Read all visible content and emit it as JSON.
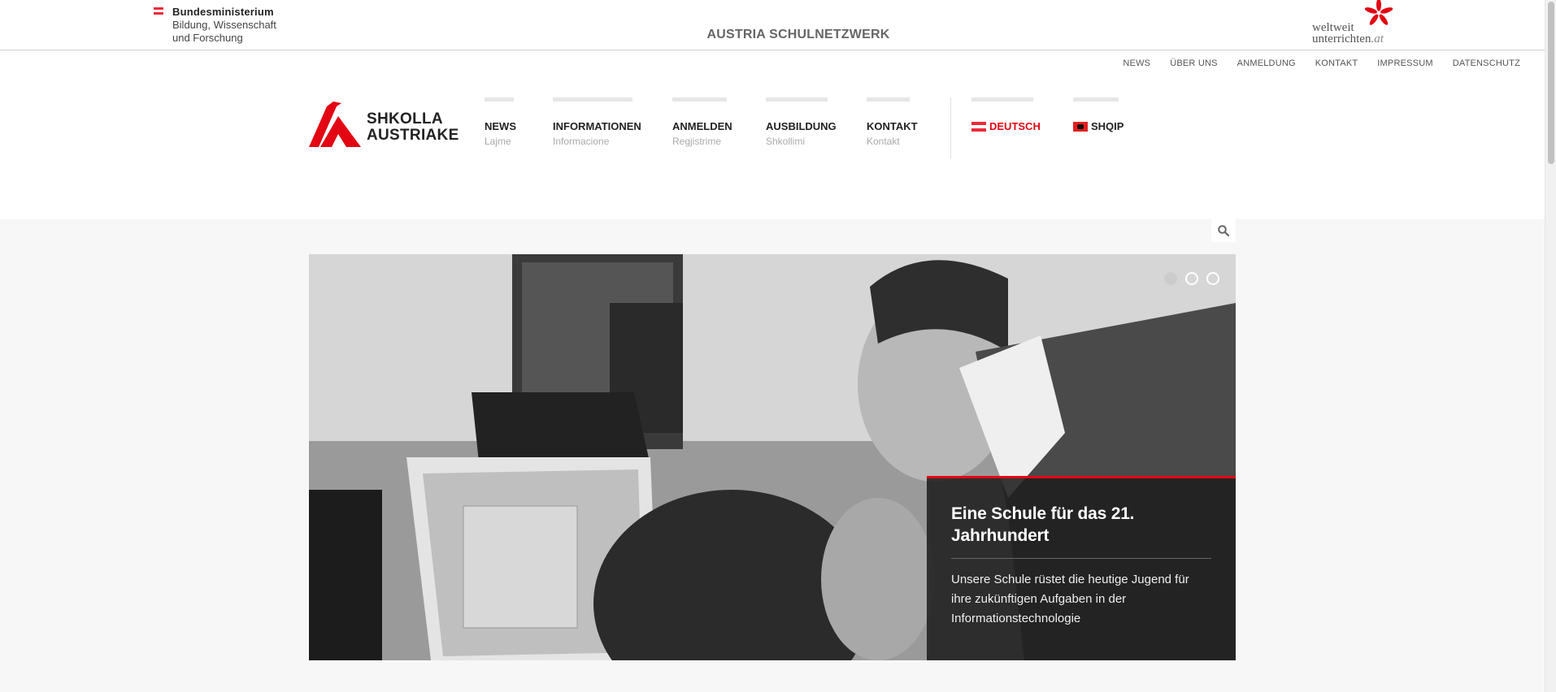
{
  "topbar": {
    "ministry_line1": "Bundesministerium",
    "ministry_line2": "Bildung, Wissenschaft",
    "ministry_line3": "und Forschung",
    "network_title": "AUSTRIA SCHULNETZWERK",
    "partner_line1": "weltweit",
    "partner_line2": "unterrichten",
    "partner_suffix": ".at"
  },
  "util_nav": [
    "NEWS",
    "ÜBER UNS",
    "ANMELDUNG",
    "KONTAKT",
    "IMPRESSUM",
    "DATENSCHUTZ"
  ],
  "logo": {
    "line1": "SHKOLLA",
    "line2": "AUSTRIAKE"
  },
  "main_nav": [
    {
      "label": "NEWS",
      "sub": "Lajme"
    },
    {
      "label": "INFORMATIONEN",
      "sub": "Informacione"
    },
    {
      "label": "ANMELDEN",
      "sub": "Regjistrime"
    },
    {
      "label": "AUSBILDUNG",
      "sub": "Shkollimi"
    },
    {
      "label": "KONTAKT",
      "sub": "Kontakt"
    }
  ],
  "languages": [
    {
      "label": "DEUTSCH",
      "active": true
    },
    {
      "label": "SHQIP",
      "active": false
    }
  ],
  "hero": {
    "title": "Eine Schule für das 21. Jahrhundert",
    "text": "Unsere Schule rüstet die heutige Jugend für ihre zukünftigen Aufgaben in der Informationstechnologie",
    "active_slide": 1,
    "slide_count": 3
  },
  "colors": {
    "accent": "#e30613",
    "austria_red": "#ed2939",
    "albania_red": "#e41e20"
  },
  "icons": {
    "search": "search-icon"
  }
}
